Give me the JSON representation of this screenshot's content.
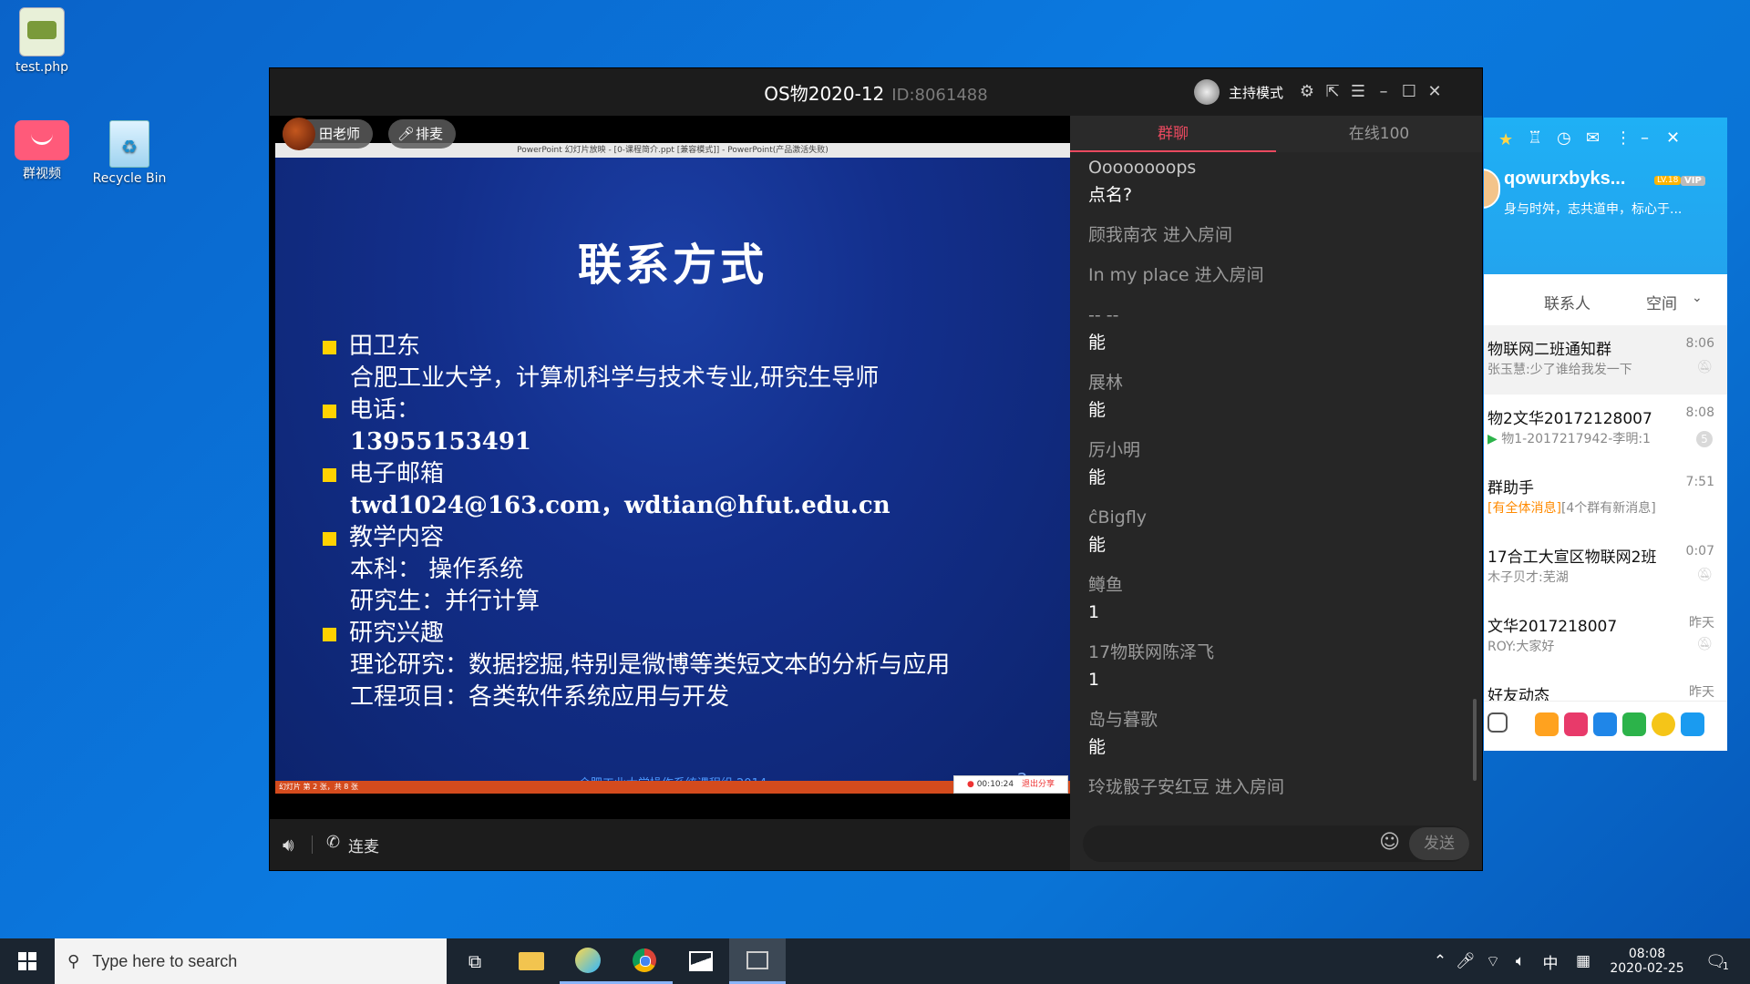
{
  "desktop": {
    "icons": [
      {
        "label": "test.php",
        "icon": "php-file-icon"
      },
      {
        "label": "群视频",
        "icon": "video-camera-icon"
      },
      {
        "label": "Recycle Bin",
        "icon": "recycle-bin-icon"
      }
    ]
  },
  "meeting": {
    "title": "OS物2020-12",
    "id": "ID:8061488",
    "host_mode": "主持模式",
    "presenter": "田老师",
    "paimai": "排麦",
    "ppt_title": "PowerPoint 幻灯片放映 - [0-课程简介.ppt [兼容模式]] - PowerPoint(产品激活失败)",
    "slide": {
      "title": "联系方式",
      "lines": [
        {
          "bullet": true,
          "text": "田卫东"
        },
        {
          "bullet": false,
          "text": "合肥工业大学，计算机科学与技术专业,研究生导师"
        },
        {
          "bullet": true,
          "text": "电话："
        },
        {
          "bullet": false,
          "text": "13955153491"
        },
        {
          "bullet": true,
          "text": "电子邮箱"
        },
        {
          "bullet": false,
          "text": "twd1024@163.com，wdtian@hfut.edu.cn"
        },
        {
          "bullet": true,
          "text": "教学内容"
        },
        {
          "bullet": false,
          "text": "本科：  操作系统"
        },
        {
          "bullet": false,
          "text": "研究生：并行计算"
        },
        {
          "bullet": true,
          "text": "研究兴趣"
        },
        {
          "bullet": false,
          "text": "理论研究：数据挖掘,特别是微博等类短文本的分析与应用"
        },
        {
          "bullet": false,
          "text": "工程项目：各类软件系统应用与开发"
        }
      ],
      "footer": "合肥工业大学操作系统课程组 2014",
      "page_number": "2",
      "status": "幻灯片 第 2 张，共 8 张",
      "rec_time": "00:10:24",
      "rec_exit": "退出分享"
    },
    "lianmai": "连麦"
  },
  "chat": {
    "tabs": [
      {
        "label": "群聊"
      },
      {
        "label": "在线100"
      }
    ],
    "items": [
      {
        "name": "Oooooooops",
        "text": "点名?"
      },
      {
        "system": "顾我南衣 进入房间"
      },
      {
        "system": "In my place 进入房间"
      },
      {
        "name": "-- --",
        "text": "能"
      },
      {
        "name": "展林",
        "text": "能"
      },
      {
        "name": "厉小明",
        "text": "能"
      },
      {
        "name": "ĉBigfly",
        "text": "能"
      },
      {
        "name": "鳟鱼",
        "text": "1"
      },
      {
        "name": "17物联网陈泽飞",
        "text": "1"
      },
      {
        "name": "岛与暮歌",
        "text": "能"
      },
      {
        "system": "玲珑骰子安红豆 进入房间"
      }
    ],
    "send_label": "发送"
  },
  "qq": {
    "nickname": "qowurxbyks...",
    "level_badge": "LV.18",
    "vip_badge": "VIP",
    "signature": "身与时舛，志共道申，标心于...",
    "tabs": [
      "联系人",
      "空间"
    ],
    "conversations": [
      {
        "name": "物联网二班通知群",
        "preview": "张玉慧:少了谁给我发一下",
        "time": "8:06"
      },
      {
        "name": "物2文华20172128007",
        "preview": "物1-2017217942-李明:1",
        "time": "8:08",
        "badge": "5"
      },
      {
        "name": "群助手",
        "preview_highlight": "[有全体消息]",
        "preview": "[4个群有新消息]",
        "time": "7:51"
      },
      {
        "name": "17合工大宣区物联网2班",
        "preview": "木子贝才:芜湖",
        "time": "0:07"
      },
      {
        "name": "文华2017218007",
        "preview": "ROY:大家好",
        "time": "昨天"
      },
      {
        "name": "好友动态",
        "preview": "",
        "time": "昨天"
      }
    ]
  },
  "taskbar": {
    "search_placeholder": "Type here to search",
    "ime": "中",
    "clock_time": "08:08",
    "clock_date": "2020-02-25",
    "notification_count": "1"
  }
}
